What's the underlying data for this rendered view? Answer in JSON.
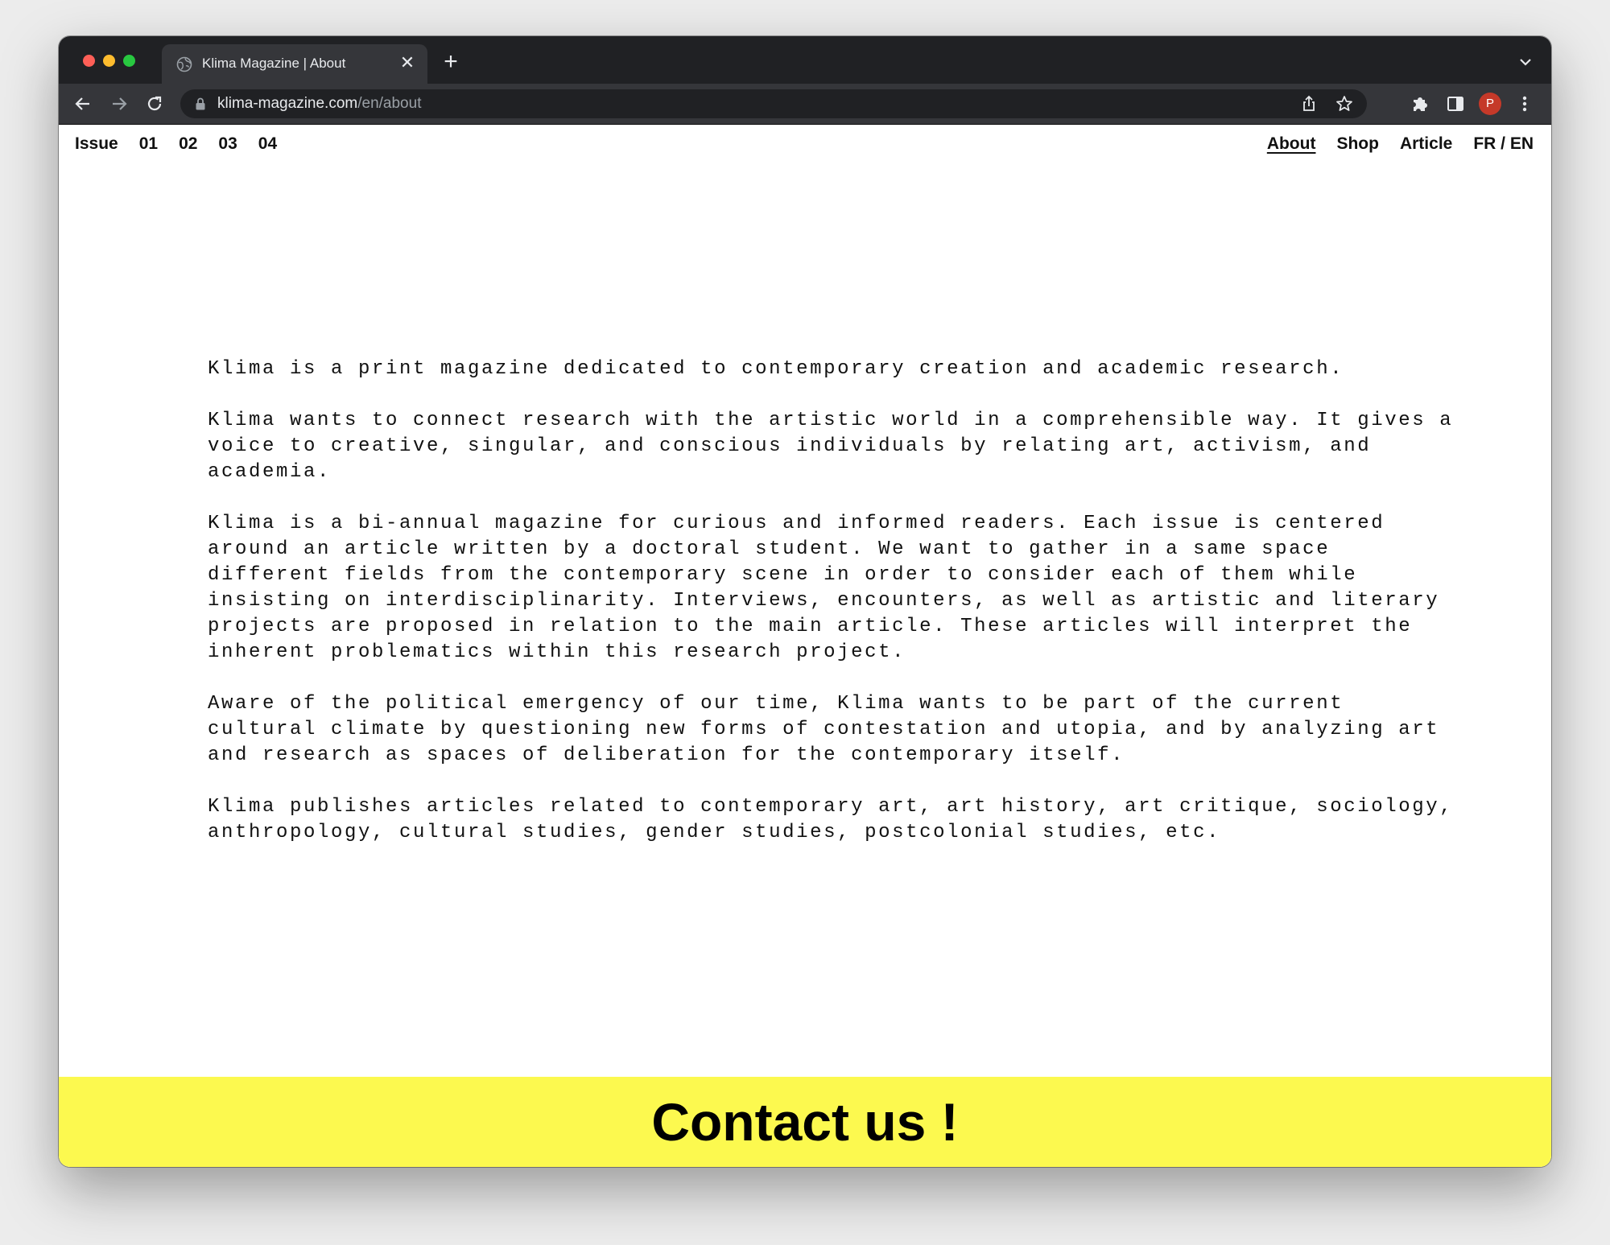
{
  "browser": {
    "tab": {
      "title": "Klima Magazine | About",
      "favicon": "globe-icon",
      "close_glyph": "✕"
    },
    "new_tab_glyph": "+",
    "address": {
      "host": "klima-magazine.com",
      "path": "/en/about"
    },
    "profile_initial": "P",
    "colors": {
      "tabbar": "#202124",
      "toolbar": "#35363a",
      "avatar": "#c53929"
    }
  },
  "site": {
    "nav_left": {
      "issue_label": "Issue",
      "issues": [
        "01",
        "02",
        "03",
        "04"
      ]
    },
    "nav_right": {
      "about_label": "About",
      "shop_label": "Shop",
      "article_label": "Article",
      "language_label": "FR / EN"
    },
    "about_paragraphs": [
      "Klima is a print magazine dedicated to contemporary creation and academic research.",
      "Klima wants to connect research with the artistic world in a comprehensible way. It gives a voice to creative, singular, and conscious individuals by relating art, activism, and academia.",
      "Klima is a bi-annual magazine for curious and informed readers. Each issue is centered around an article written by a doctoral student. We want to gather in a same space different fields from the contemporary scene in order to consider each of them while insisting on interdisciplinarity. Interviews, encounters, as well as artistic and literary projects are proposed in relation to the main article. These articles will interpret the inherent problematics within this research project.",
      "Aware of the political emergency of our time, Klima wants to be part of the current cultural climate by questioning new forms of contestation and utopia, and by analyzing art and research as spaces of deliberation for the contemporary itself.",
      "Klima publishes articles related to contemporary art, art history, art critique, sociology, anthropology, cultural studies, gender studies, postcolonial studies, etc."
    ],
    "contact_label": "Contact us !",
    "colors": {
      "contact_bar": "#fcf94f",
      "text": "#111111"
    }
  }
}
